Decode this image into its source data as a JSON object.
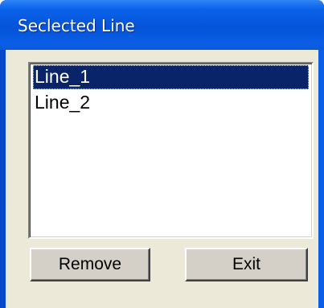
{
  "window": {
    "title": "Seclected Line"
  },
  "list": {
    "items": [
      "Line_1",
      "Line_2"
    ],
    "selected_index": 0
  },
  "buttons": {
    "remove_label": "Remove",
    "exit_label": "Exit"
  },
  "colors": {
    "titlebar": "#0553d8",
    "title_text": "#ffffff",
    "client_bg": "#ece9d8",
    "selection_bg": "#0a246a",
    "selection_text": "#ffffff",
    "button_face": "#d4d0c8"
  }
}
